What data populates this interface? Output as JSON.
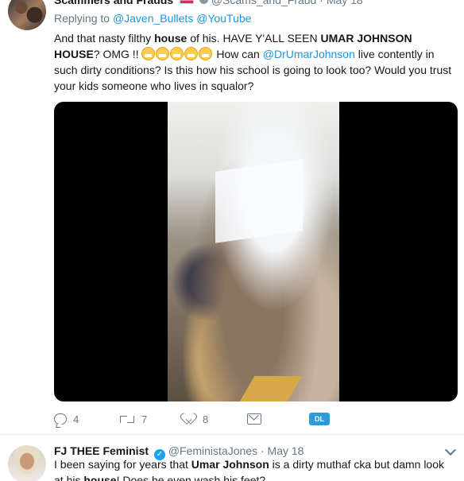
{
  "tweet1": {
    "author_name": "Scammers and Frauds",
    "handle": "@Scams_and_Fraud",
    "date": "May 18",
    "replying_label": "Replying to",
    "replying_to": [
      "@Javen_Bullets",
      "@YouTube"
    ],
    "text": {
      "p1": "And that nasty filthy ",
      "b1": "house",
      "p2": " of his. HAVE Y'ALL SEEN ",
      "b2": "UMAR JOHNSON HOUSE",
      "p3": "? OMG !! ",
      "p4": " How can ",
      "mention": "@DrUmarJohnson",
      "p5": " live contently in such dirty conditions? Is this how his school is going to look too? Would you trust your kids someone who lives in squalor?"
    },
    "actions": {
      "replies": "4",
      "retweets": "7",
      "likes": "8",
      "dl_badge": "DL"
    },
    "icons": [
      "reply-icon",
      "retweet-icon",
      "like-icon",
      "direct-message-icon",
      "chevron-down-icon"
    ]
  },
  "tweet2": {
    "author_name": "FJ THEE Feminist",
    "verified_icon": "verified-icon",
    "handle": "@FeministaJones",
    "date": "May 18",
    "text": {
      "p1": "I been saying for years that ",
      "b1": "Umar Johnson",
      "p2": " is a dirty muthaf",
      "p3": "cka but damn look at his ",
      "b2": "house",
      "p4": "! Does he even wash his feet?"
    }
  },
  "colors": {
    "link": "#1b95e0",
    "muted": "#657786",
    "text": "#14171a",
    "verified": "#1da1f2",
    "dl_badge": "#2d9bd8"
  }
}
